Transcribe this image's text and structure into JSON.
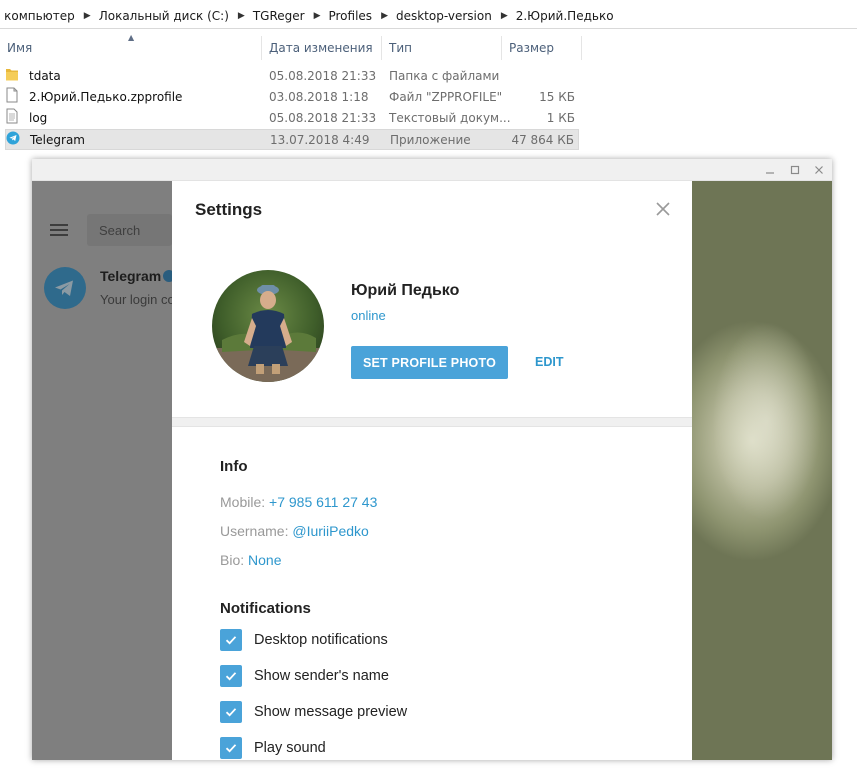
{
  "explorer": {
    "breadcrumb": [
      "г компьютер",
      "Локальный диск (C:)",
      "TGReger",
      "Profiles",
      "desktop-version",
      "2.Юрий.Педько"
    ],
    "columns": {
      "name": "Имя",
      "date": "Дата изменения",
      "type": "Тип",
      "size": "Размер"
    },
    "files": [
      {
        "name": "tdata",
        "date": "05.08.2018 21:33",
        "type": "Папка с файлами",
        "size": "",
        "icon": "folder-icon"
      },
      {
        "name": "2.Юрий.Педько.zpprofile",
        "date": "03.08.2018 1:18",
        "type": "Файл \"ZPPROFILE\"",
        "size": "15 КБ",
        "icon": "file-icon"
      },
      {
        "name": "log",
        "date": "05.08.2018 21:33",
        "type": "Текстовый докум...",
        "size": "1 КБ",
        "icon": "text-file-icon"
      },
      {
        "name": "Telegram",
        "date": "13.07.2018 4:49",
        "type": "Приложение",
        "size": "47 864 КБ",
        "icon": "telegram-icon"
      }
    ]
  },
  "telegram": {
    "sidebar": {
      "search_placeholder": "Search",
      "chat_title": "Telegram",
      "chat_preview": "Your login co"
    },
    "settings": {
      "title": "Settings",
      "profile": {
        "name": "Юрий Педько",
        "status": "online",
        "set_photo_label": "SET PROFILE PHOTO",
        "edit_label": "EDIT"
      },
      "info": {
        "heading": "Info",
        "mobile_label": "Mobile:",
        "mobile_value": "+7 985 611 27 43",
        "username_label": "Username:",
        "username_value": "@IuriiPedko",
        "bio_label": "Bio:",
        "bio_value": "None"
      },
      "notifications": {
        "heading": "Notifications",
        "options": [
          {
            "label": "Desktop notifications",
            "checked": true
          },
          {
            "label": "Show sender's name",
            "checked": true
          },
          {
            "label": "Show message preview",
            "checked": true
          },
          {
            "label": "Play sound",
            "checked": true
          }
        ]
      }
    }
  },
  "colors": {
    "accent": "#4aa3d9",
    "link": "#2e97cd",
    "overlay": "#7b7b7b"
  }
}
